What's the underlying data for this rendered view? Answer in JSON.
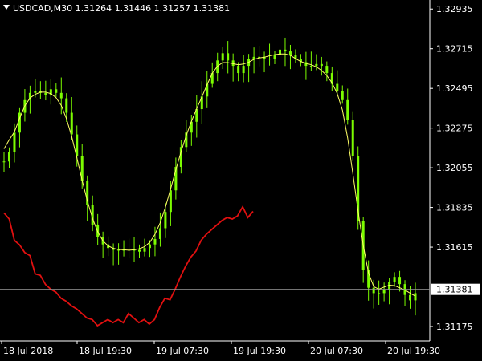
{
  "header": {
    "symbol": "USDCAD,M30",
    "open": "1.31264",
    "high": "1.31446",
    "low": "1.31257",
    "close": "1.31381"
  },
  "colors": {
    "background": "#000000",
    "candles": "#7CFC00",
    "ma_line": "#FFFF66",
    "indicator_line": "#E01010",
    "axis": "#FFFFFF",
    "price_line": "#9a9a9a"
  },
  "chart_data": {
    "type": "line",
    "title": "USDCAD,M30",
    "y_ticks": [
      "1.32935",
      "1.32715",
      "1.32495",
      "1.32275",
      "1.32055",
      "1.31835",
      "1.31615",
      "1.31175"
    ],
    "y_tick_values": [
      1.32935,
      1.32715,
      1.32495,
      1.32275,
      1.32055,
      1.31835,
      1.31615,
      1.31175
    ],
    "ylim": [
      1.31095,
      1.32985
    ],
    "x_ticks": [
      "18 Jul 2018",
      "18 Jul 19:30",
      "19 Jul 07:30",
      "19 Jul 19:30",
      "20 Jul 07:30",
      "20 Jul 19:30"
    ],
    "current_price": 1.31381,
    "current_price_label": "1.31381",
    "series": [
      {
        "kind": "close",
        "values": [
          1.3209,
          1.3214,
          1.3225,
          1.3236,
          1.3243,
          1.3247,
          1.3248,
          1.3247,
          1.3246,
          1.3249,
          1.3247,
          1.3244,
          1.3236,
          1.3224,
          1.3212,
          1.3198,
          1.3185,
          1.3174,
          1.3167,
          1.3163,
          1.3161,
          1.316,
          1.316,
          1.316,
          1.316,
          1.316,
          1.3159,
          1.3161,
          1.3163,
          1.3166,
          1.3172,
          1.3181,
          1.3193,
          1.3206,
          1.3217,
          1.3225,
          1.3231,
          1.3238,
          1.3245,
          1.3252,
          1.3258,
          1.3265,
          1.3269,
          1.3265,
          1.3262,
          1.3258,
          1.3262,
          1.3266,
          1.3267,
          1.3267,
          1.3266,
          1.3266,
          1.3268,
          1.3271,
          1.327,
          1.3268,
          1.3266,
          1.3264,
          1.3262,
          1.3262,
          1.3263,
          1.3262,
          1.3258,
          1.3252,
          1.3248,
          1.3243,
          1.3232,
          1.3212,
          1.3176,
          1.3149,
          1.3139,
          1.3136,
          1.3136,
          1.3138,
          1.3142,
          1.3145,
          1.3141,
          1.3135,
          1.3132,
          1.3136
        ]
      },
      {
        "kind": "indicator",
        "values": [
          0.84,
          0.8,
          0.66,
          0.63,
          0.58,
          0.56,
          0.44,
          0.43,
          0.37,
          0.34,
          0.32,
          0.28,
          0.26,
          0.23,
          0.21,
          0.18,
          0.15,
          0.14,
          0.1,
          0.12,
          0.14,
          0.12,
          0.14,
          0.12,
          0.18,
          0.15,
          0.12,
          0.14,
          0.11,
          0.14,
          0.22,
          0.28,
          0.27,
          0.34,
          0.42,
          0.49,
          0.55,
          0.59,
          0.66,
          0.7,
          0.73,
          0.76,
          0.79,
          0.81,
          0.8,
          0.82,
          0.88,
          0.81,
          0.85
        ]
      }
    ],
    "grid": false
  }
}
